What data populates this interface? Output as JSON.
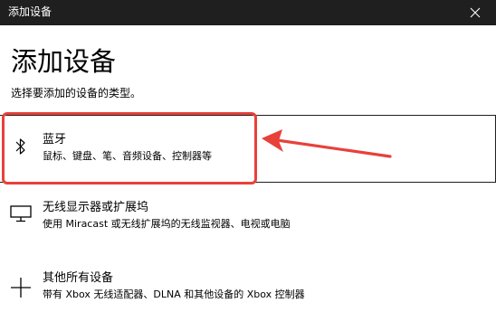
{
  "window": {
    "title": "添加设备"
  },
  "main": {
    "heading": "添加设备",
    "subtitle": "选择要添加的设备的类型。"
  },
  "options": [
    {
      "icon": "bluetooth-icon",
      "title": "蓝牙",
      "description": "鼠标、键盘、笔、音频设备、控制器等"
    },
    {
      "icon": "monitor-icon",
      "title": "无线显示器或扩展坞",
      "description": "使用 Miracast 或无线扩展坞的无线监视器、电视或电脑"
    },
    {
      "icon": "plus-icon",
      "title": "其他所有设备",
      "description": "带有 Xbox 无线适配器、DLNA 和其他设备的 Xbox 控制器"
    }
  ],
  "annotation": {
    "color": "#e8413a",
    "arrow": "red-arrow-icon"
  }
}
